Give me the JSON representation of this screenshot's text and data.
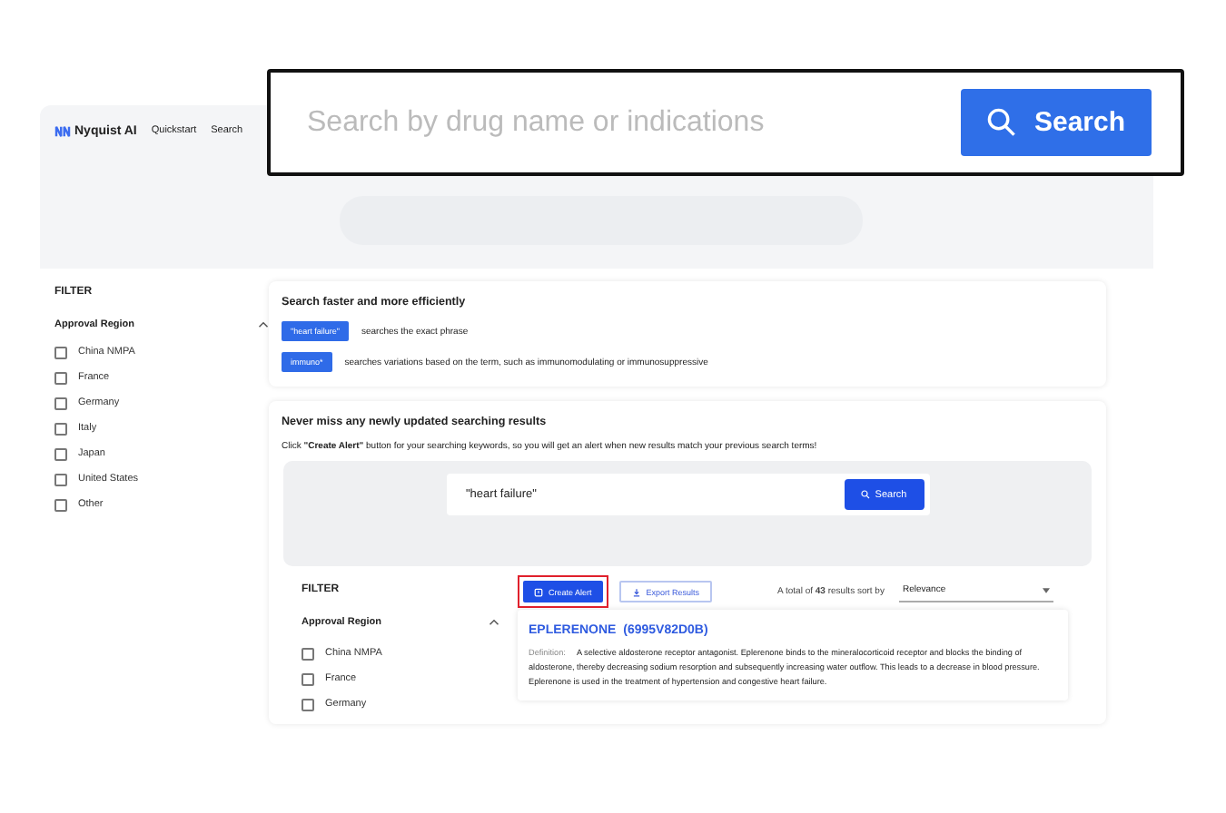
{
  "nav": {
    "brand": "Nyquist AI",
    "links": [
      "Quickstart",
      "Search"
    ]
  },
  "search_overlay": {
    "placeholder": "Search by drug name or indications",
    "button": "Search"
  },
  "sidebar": {
    "title": "FILTER",
    "section": "Approval Region",
    "expanded": true,
    "options": [
      {
        "label": "China NMPA",
        "checked": false
      },
      {
        "label": "France",
        "checked": false
      },
      {
        "label": "Germany",
        "checked": false
      },
      {
        "label": "Italy",
        "checked": false
      },
      {
        "label": "Japan",
        "checked": false
      },
      {
        "label": "United States",
        "checked": false
      },
      {
        "label": "Other",
        "checked": false
      }
    ]
  },
  "tips": {
    "title": "Search faster and more efficiently",
    "examples": [
      {
        "chip": "\"heart failure\"",
        "text": "searches the exact phrase"
      },
      {
        "chip": "immuno*",
        "text": "searches variations based on the term, such as immunomodulating or immunosuppressive"
      }
    ]
  },
  "alert_panel": {
    "title": "Never miss any newly updated searching results",
    "description": "Click **\"Create Alert\"** button for your searching keywords, so you will get an alert when new results match your previous search terms!",
    "search": {
      "value": "\"heart failure\"",
      "button": "Search"
    },
    "filter": {
      "title": "FILTER",
      "section": "Approval Region",
      "expanded": true,
      "options": [
        {
          "label": "China NMPA",
          "checked": false
        },
        {
          "label": "France",
          "checked": false
        },
        {
          "label": "Germany",
          "checked": false
        }
      ]
    },
    "actions": [
      {
        "label": "Create Alert",
        "kind": "primary",
        "highlighted": true
      },
      {
        "label": "Export Results",
        "kind": "outline",
        "highlighted": false
      }
    ],
    "summary": "A total of **43** results sort by",
    "sort": "Relevance",
    "result": {
      "title": "EPLERENONE  (6995V82D0B)",
      "definition_label": "Definition:",
      "definition": "A selective aldosterone receptor antagonist. Eplerenone binds to the mineralocorticoid receptor and blocks the binding of aldosterone, thereby decreasing sodium resorption and subsequently increasing water outflow. This leads to a decrease in blood pressure. Eplerenone is used in the treatment of hypertension and congestive heart failure."
    }
  }
}
